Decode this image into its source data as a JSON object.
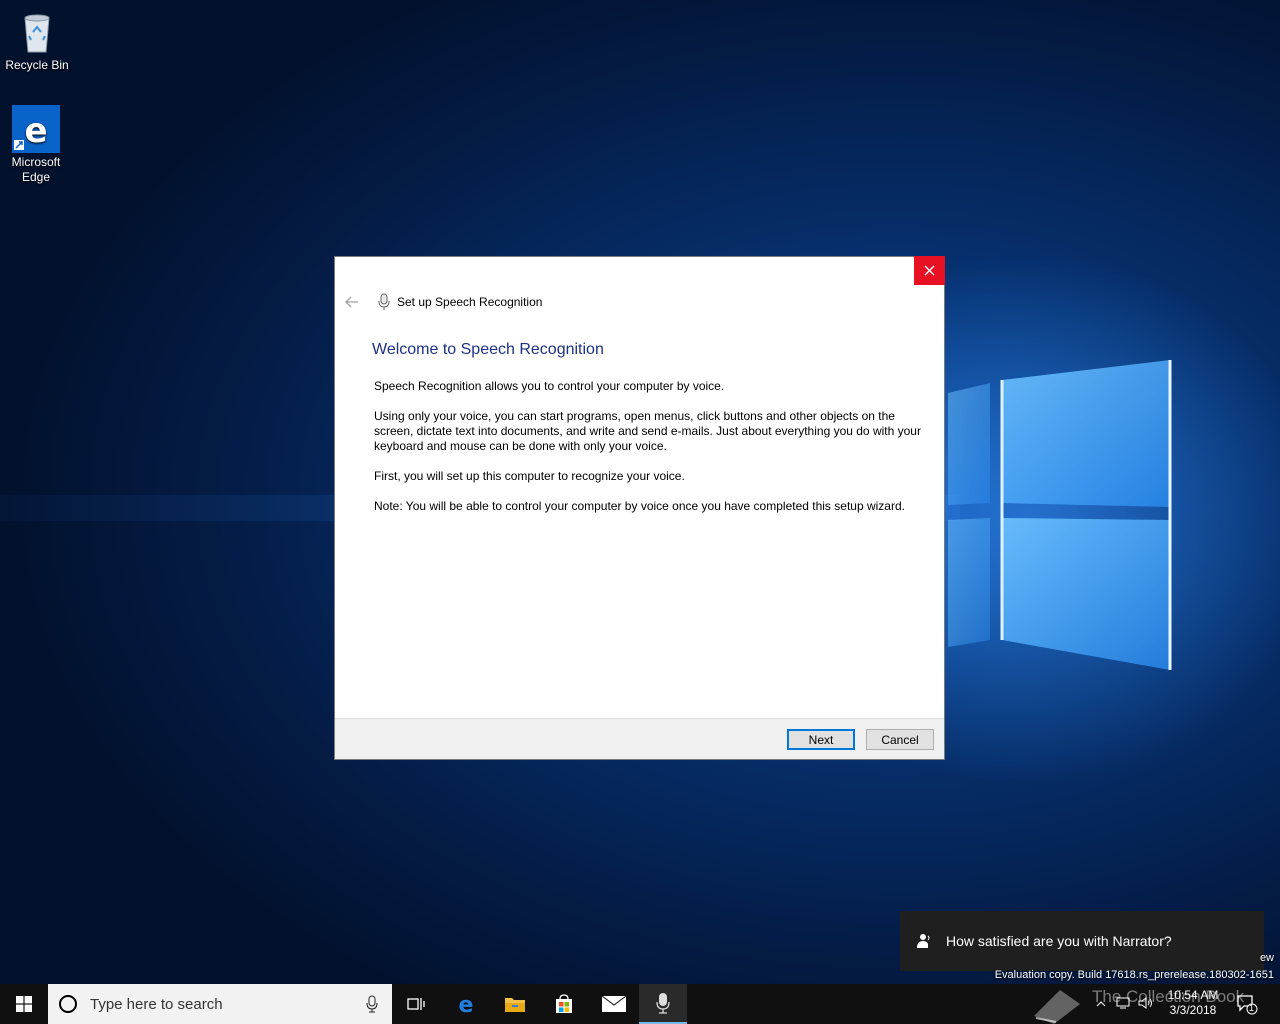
{
  "desktop": {
    "icons": [
      {
        "label": "Recycle Bin",
        "icon": "recycle-bin-icon"
      },
      {
        "label": "Microsoft Edge",
        "icon": "edge-icon"
      }
    ],
    "watermark_line1": "ew",
    "watermark_line2": "Evaluation copy. Build 17618.rs_prerelease.180302-1651"
  },
  "dialog": {
    "title": "Set up Speech Recognition",
    "heading": "Welcome to Speech Recognition",
    "paragraphs": [
      "Speech Recognition allows you to control your computer by voice.",
      "Using only your voice, you can start programs, open menus, click buttons and other objects on the screen, dictate text into documents, and write and send e-mails. Just about everything you do with your keyboard and mouse can be done with only your voice.",
      "First, you will set up this computer to recognize your voice.",
      "Note: You will be able to control your computer by voice once you have completed this setup wizard."
    ],
    "next_label": "Next",
    "cancel_label": "Cancel",
    "close_color": "#e81123"
  },
  "toast": {
    "text": "How satisfied are you with Narrator?"
  },
  "taskbar": {
    "search_placeholder": "Type here to search",
    "apps": [
      "task-view-icon",
      "edge-icon",
      "file-explorer-icon",
      "store-icon",
      "mail-icon",
      "speech-recognition-icon"
    ],
    "time": "10:54 AM",
    "date": "3/3/2018",
    "notification_count": "1",
    "brand_overlay": "The Collection Book"
  },
  "colors": {
    "accent": "#0078d7",
    "heading": "#1e3287",
    "taskbar": "#101010"
  }
}
